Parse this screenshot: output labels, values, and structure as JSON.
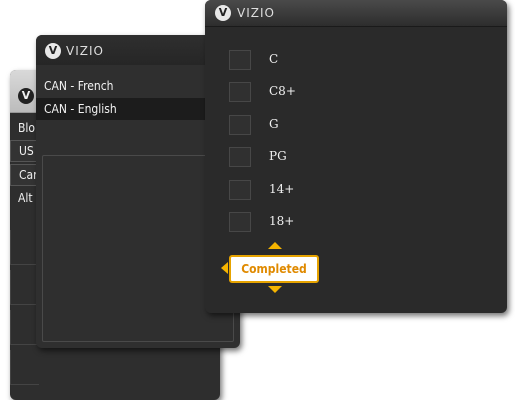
{
  "brand": {
    "name": "VIZIO",
    "logo_letter": "V"
  },
  "panel_back": {
    "items": [
      "Blo",
      "US",
      "Car",
      "Alt"
    ]
  },
  "panel_middle": {
    "options": [
      "CAN - French",
      "CAN - English"
    ],
    "selected_index": 1
  },
  "panel_front": {
    "ratings": [
      {
        "label": "C",
        "checked": false
      },
      {
        "label": "C8+",
        "checked": false
      },
      {
        "label": "G",
        "checked": false
      },
      {
        "label": "PG",
        "checked": false
      },
      {
        "label": "14+",
        "checked": false
      },
      {
        "label": "18+",
        "checked": false
      }
    ],
    "completed_label": "Completed"
  },
  "colors": {
    "accent": "#f5b400",
    "completed_text": "#e08a00",
    "panel_bg": "#2a2a2a"
  }
}
